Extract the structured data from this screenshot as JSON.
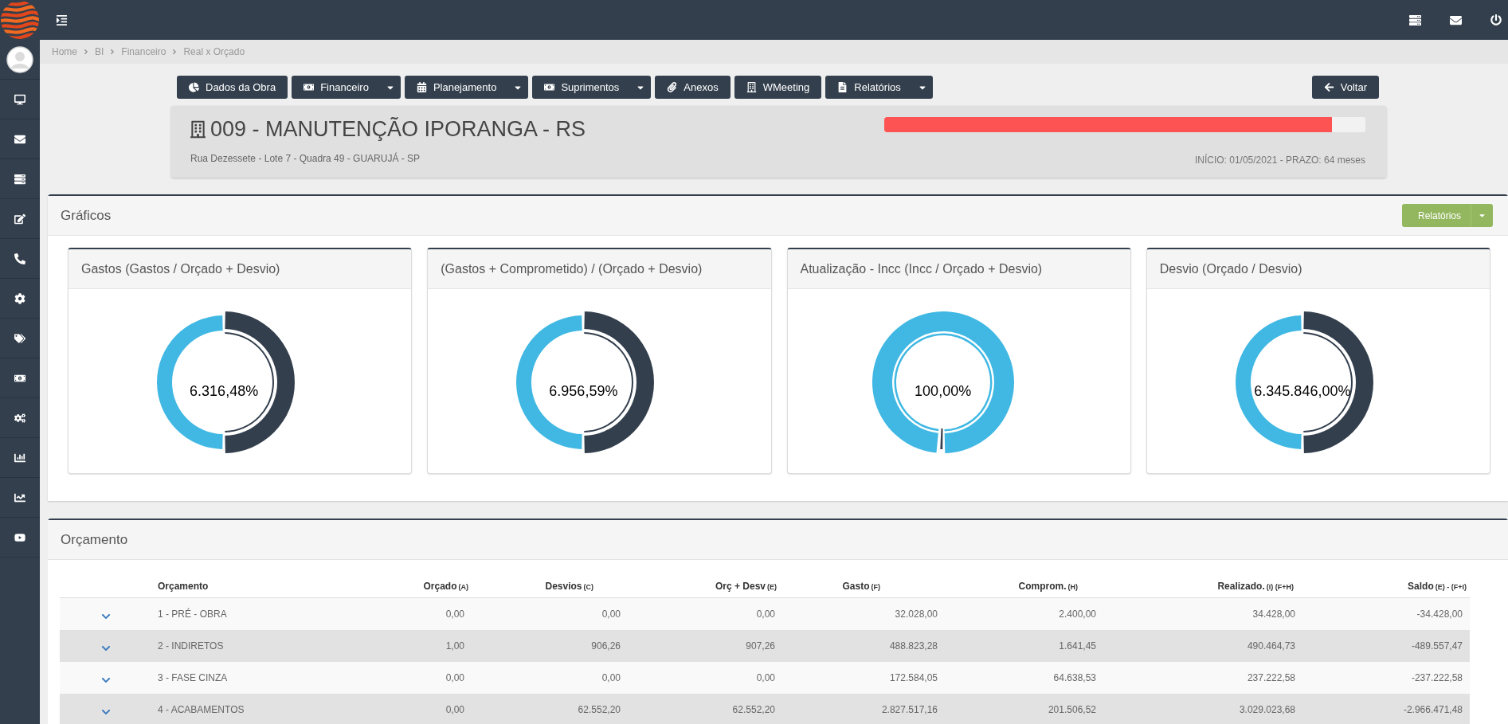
{
  "breadcrumb": [
    "Home",
    "BI",
    "Financeiro",
    "Real x Orçado"
  ],
  "toolbar": {
    "buttons": [
      {
        "label": "Dados da Obra",
        "dropdown": false
      },
      {
        "label": "Financeiro",
        "dropdown": true
      },
      {
        "label": "Planejamento",
        "dropdown": true
      },
      {
        "label": "Suprimentos",
        "dropdown": true
      },
      {
        "label": "Anexos",
        "dropdown": false
      },
      {
        "label": "WMeeting",
        "dropdown": false
      },
      {
        "label": "Relatórios",
        "dropdown": true
      }
    ],
    "back_button": "Voltar"
  },
  "project": {
    "title": "009 - MANUTENÇÃO IPORANGA - RS",
    "address": "Rua Dezessete - Lote 7 - Quadra 49 - GUARUJÁ - SP",
    "progress": {
      "level": 0.93
    },
    "schedule": "INÍCIO: 01/05/2021 - PRAZO: 64 meses"
  },
  "charts_panel": {
    "title": "Gráficos",
    "reports_button": "Relatórios",
    "charts": [
      {
        "title": "Gastos (Gastos / Orçado + Desvio)",
        "value": "6.316,48%",
        "kind": "split"
      },
      {
        "title": "(Gastos + Comprometido) / (Orçado + Desvio)",
        "value": "6.956,59%",
        "kind": "split"
      },
      {
        "title": "Atualização - Incc (Incc / Orçado + Desvio)",
        "value": "100,00%",
        "kind": "full"
      },
      {
        "title": "Desvio (Orçado / Desvio)",
        "value": "6.345.846,00%",
        "kind": "split"
      }
    ]
  },
  "budget_panel": {
    "title": "Orçamento",
    "table": {
      "columns": [
        {
          "label": "Orçamento"
        },
        {
          "label": "Orçado",
          "note": "(A)"
        },
        {
          "label": "Desvios",
          "note": "(C)"
        },
        {
          "label": "Orç + Desv",
          "note": "(E)"
        },
        {
          "label": "Gasto",
          "note": "(F)"
        },
        {
          "label": "Comprom.",
          "note": "(H)"
        },
        {
          "label": "Realizado.",
          "note": "(I) (F+H)"
        },
        {
          "label": "Saldo",
          "note": "(E) - (F+I)"
        }
      ],
      "rows": [
        {
          "expanded": false,
          "cells": [
            "1 - PRÉ - OBRA",
            "0,00",
            "0,00",
            "0,00",
            "32.028,00",
            "2.400,00",
            "34.428,00",
            "-34.428,00"
          ]
        },
        {
          "expanded": false,
          "cells": [
            "2 - INDIRETOS",
            "1,00",
            "906,26",
            "907,26",
            "488.823,28",
            "1.641,45",
            "490.464,73",
            "-489.557,47"
          ]
        },
        {
          "expanded": false,
          "cells": [
            "3 - FASE CINZA",
            "0,00",
            "0,00",
            "0,00",
            "172.584,05",
            "64.638,53",
            "237.222,58",
            "-237.222,58"
          ]
        },
        {
          "expanded": false,
          "cells": [
            "4 - ACABAMENTOS",
            "0,00",
            "62.552,20",
            "62.552,20",
            "2.827.517,16",
            "201.506,52",
            "3.029.023,68",
            "-2.966.471,48"
          ]
        }
      ]
    }
  }
}
